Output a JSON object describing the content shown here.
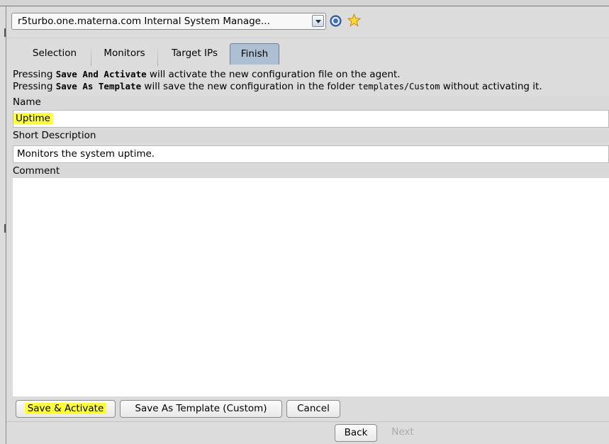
{
  "header": {
    "select_value": "r5turbo.one.materna.com Internal System Manage...",
    "help_icon": "help-icon",
    "favorite_icon": "star-icon"
  },
  "tabs": [
    {
      "label": "Selection",
      "active": false
    },
    {
      "label": "Monitors",
      "active": false
    },
    {
      "label": "Target IPs",
      "active": false
    },
    {
      "label": "Finish",
      "active": true
    }
  ],
  "info": {
    "line1_prefix": "Pressing ",
    "line1_bold": "Save And Activate",
    "line1_suffix": " will activate the new configuration file on the agent.",
    "line2_prefix": "Pressing ",
    "line2_bold": "Save As Template",
    "line2_mid": " will save the new configuration in the folder ",
    "line2_code": "templates/Custom",
    "line2_suffix": " without activating it."
  },
  "form": {
    "name_label": "Name",
    "name_value": "Uptime",
    "short_desc_label": "Short Description",
    "short_desc_value": "Monitors the system uptime.",
    "comment_label": "Comment",
    "comment_value": ""
  },
  "actions": {
    "save_activate": "Save & Activate",
    "save_template": "Save As Template (Custom)",
    "cancel": "Cancel"
  },
  "nav": {
    "back": "Back",
    "next": "Next"
  },
  "colors": {
    "highlight": "#ffff3c",
    "active_tab": "#adbfd3",
    "background": "#dcdcdc"
  }
}
